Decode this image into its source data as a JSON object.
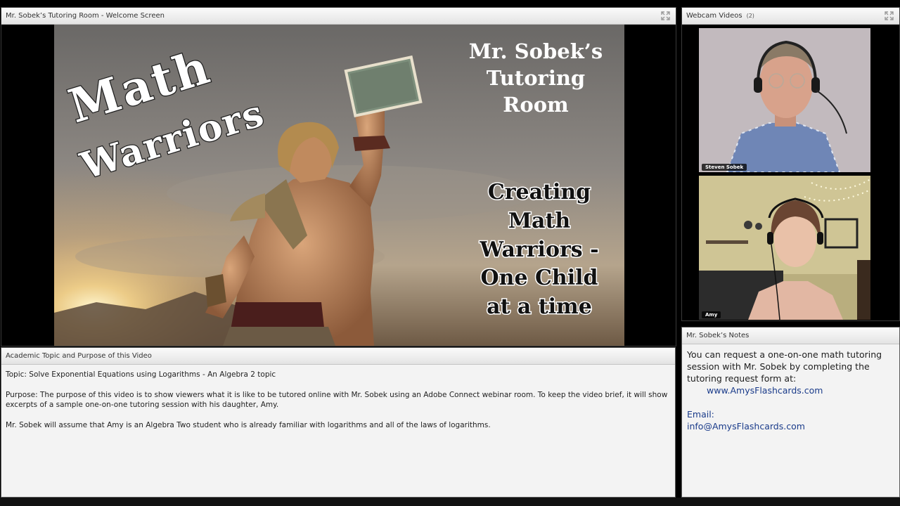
{
  "share_pod": {
    "title": "Mr. Sobek’s Tutoring Room - Welcome Screen",
    "slide": {
      "math_line": "Math",
      "warriors_line": "Warriors",
      "room_title_lines": [
        "Mr. Sobek’s",
        "Tutoring",
        "Room"
      ],
      "tagline_lines": [
        "Creating",
        "Math",
        "Warriors -",
        "One Child",
        "at a time"
      ]
    }
  },
  "webcam_pod": {
    "title": "Webcam Videos",
    "count": "(2)",
    "cams": [
      {
        "name": "Steven Sobek"
      },
      {
        "name": "Amy"
      }
    ]
  },
  "topic_pod": {
    "title": "Academic Topic and Purpose of this Video",
    "topic": "Topic: Solve Exponential Equations using Logarithms - An Algebra 2 topic",
    "purpose": "Purpose: The purpose of this video is to show viewers what it is like to be tutored online with Mr. Sobek using an Adobe Connect webinar room.  To keep the video brief, it will show excerpts of a sample one-on-one tutoring session with his daughter, Amy.",
    "assumption": "Mr. Sobek will assume that Amy is an Algebra Two student who is already familiar with logarithms and all of the laws of logarithms."
  },
  "notes_pod": {
    "title": "Mr. Sobek’s Notes",
    "intro": "You can request a one-on-one math tutoring session with Mr. Sobek by completing the tutoring request form at:",
    "website": "www.AmysFlashcards.com",
    "email_label": "Email:",
    "email": "info@AmysFlashcards.com"
  },
  "colors": {
    "link": "#1a3b8a",
    "header_bg": "#ececec",
    "slide_text": "#ffffff"
  }
}
